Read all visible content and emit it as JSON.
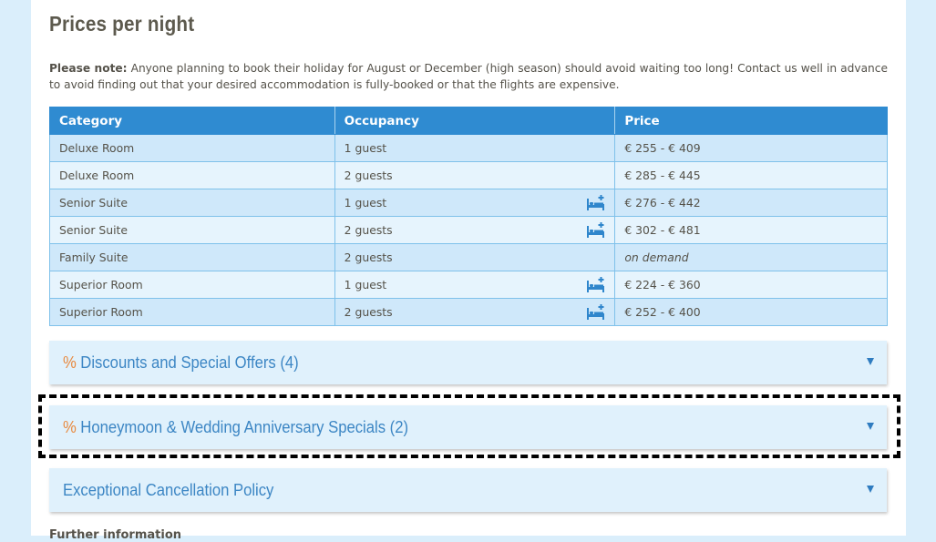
{
  "section": {
    "title": "Prices per night",
    "note_label": "Please note:",
    "note_text": " Anyone planning to book their holiday for August or December (high season) should avoid waiting too long! Contact us well in advance to avoid finding out that your desired accommodation is fully-booked or that the flights are expensive."
  },
  "table": {
    "headers": [
      "Category",
      "Occupancy",
      "Price"
    ],
    "rows": [
      {
        "category": "Deluxe Room",
        "occupancy": "1 guest",
        "price": "€ 255 - € 409",
        "extra_bed": false
      },
      {
        "category": "Deluxe Room",
        "occupancy": "2 guests",
        "price": "€ 285 - € 445",
        "extra_bed": false
      },
      {
        "category": "Senior Suite",
        "occupancy": "1 guest",
        "price": "€ 276 - € 442",
        "extra_bed": true
      },
      {
        "category": "Senior Suite",
        "occupancy": "2 guests",
        "price": "€ 302 - € 481",
        "extra_bed": true
      },
      {
        "category": "Family Suite",
        "occupancy": "2 guests",
        "price": "on demand",
        "extra_bed": false
      },
      {
        "category": "Superior Room",
        "occupancy": "1 guest",
        "price": "€ 224 - € 360",
        "extra_bed": true
      },
      {
        "category": "Superior Room",
        "occupancy": "2 guests",
        "price": "€ 252 - € 400",
        "extra_bed": true
      }
    ]
  },
  "accordions": [
    {
      "prefix": "%",
      "label": "Discounts and Special Offers (4)"
    },
    {
      "prefix": "%",
      "label": "Honeymoon & Wedding Anniversary Specials (2)"
    },
    {
      "prefix": "",
      "label": "Exceptional Cancellation Policy"
    }
  ],
  "next_section_title": "Further information",
  "colors": {
    "header_blue": "#2f8bd1",
    "row_odd": "#cfe8fa",
    "row_even": "#e6f4fd",
    "accordion_bg": "#e0f1fc",
    "accordion_text": "#3c86c4",
    "percent_orange": "#e8893e",
    "page_bg": "#daeefb"
  },
  "icons": {
    "extra_bed": "bed-plus-icon",
    "expand": "triangle-down-icon"
  }
}
